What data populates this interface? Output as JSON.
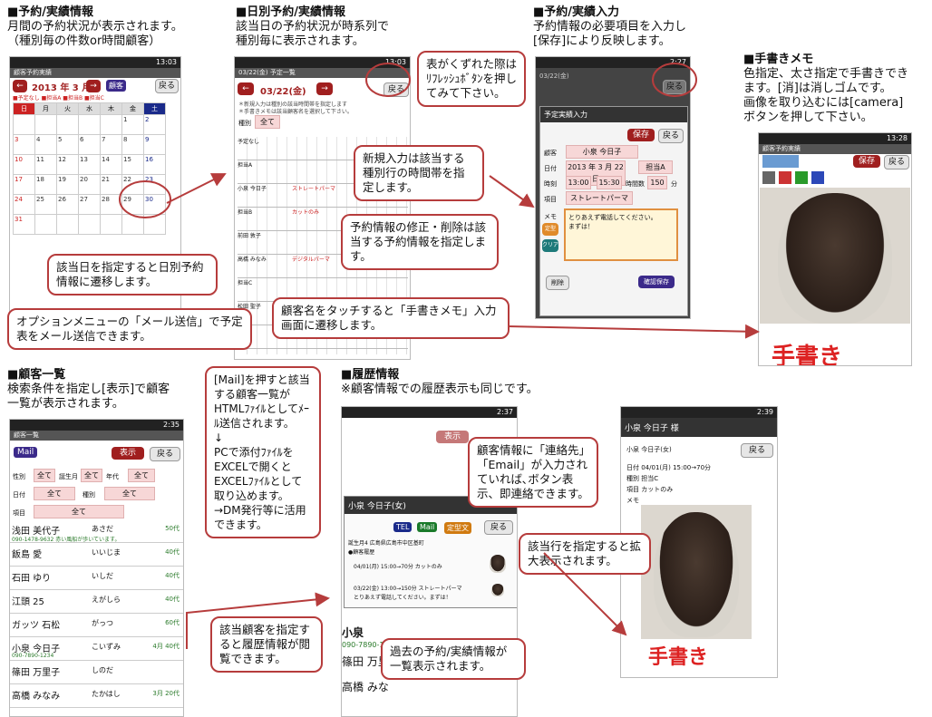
{
  "sections": {
    "s1": {
      "title": "■予約/実績情報",
      "l1": "月間の予約状況が表示されます。",
      "l2": "（種別毎の件数or時間顧客）"
    },
    "s2": {
      "title": "■日別予約/実績情報",
      "l1": "該当日の予約状況が時系列で",
      "l2": "種別毎に表示されます。"
    },
    "s3": {
      "title": "■予約/実績入力",
      "l1": "予約情報の必要項目を入力し",
      "l2": "[保存]により反映します。"
    },
    "s4": {
      "title": "■手書きメモ",
      "l1": "色指定、太さ指定で手書きでき",
      "l2": "ます。[消]は消しゴムです。",
      "l3": "画像を取り込むには[camera]",
      "l4": "ボタンを押して下さい。"
    },
    "s5": {
      "title": "■顧客一覧",
      "l1": "検索条件を指定し[表示]で顧客",
      "l2": "一覧が表示されます。"
    },
    "s6": {
      "title": "■履歴情報",
      "l1": "※顧客情報での履歴表示も同じです。"
    }
  },
  "callouts": {
    "c1": "該当日を指定すると日別予約情報に遷移します。",
    "c2": "表がくずれた際はﾘﾌﾚｯｼｭﾎﾞﾀﾝを押してみて下さい。",
    "c3": "新規入力は該当する種別行の時間帯を指定します。",
    "c4": "予約情報の修正・削除は該当する予約情報を指定します。",
    "c5": "顧客名をタッチすると「手書きメモ」入力画面に遷移します。",
    "c6": "オプションメニューの「メール送信」で予定表をメール送信できます。",
    "c7": "[Mail]を押すと該当する顧客一覧がHTMLﾌｧｲﾙとしてﾒｰﾙ送信されます。\n↓\nPCで添付ﾌｧｲﾙをEXCELで開くとEXCELﾌｧｲﾙとして取り込めます。\n→DM発行等に活用できます。",
    "c8": "顧客情報に「連絡先」「Email」が入力されていれば､ボタン表示、即連絡できます。",
    "c9": "該当行を指定すると拡大表示されます。",
    "c10": "該当顧客を指定すると履歴情報が閲覧できます。",
    "c11": "過去の予約/実績情報が一覧表示されます。"
  },
  "phone1": {
    "time": "13:03",
    "title": "顧客予約実績",
    "month": "2013 年 3 月",
    "cust": "顧客",
    "back": "戻る",
    "legend": [
      "予定なし",
      "担当A",
      "担当B",
      "担当C"
    ],
    "days": [
      "日",
      "月",
      "火",
      "水",
      "木",
      "金",
      "土"
    ],
    "dates": [
      "",
      "",
      "",
      "",
      "",
      "1",
      "2",
      "3",
      "4",
      "5",
      "6",
      "7",
      "8",
      "9",
      "10",
      "11",
      "12",
      "13",
      "14",
      "15",
      "16",
      "17",
      "18",
      "19",
      "20",
      "21",
      "22",
      "23",
      "24",
      "25",
      "26",
      "27",
      "28",
      "29",
      "30",
      "31",
      "",
      "",
      "",
      "",
      "",
      ""
    ]
  },
  "phone2": {
    "time": "13:03",
    "title": "03/22(金) 予定一覧",
    "date": "03/22(金)",
    "back": "戻る",
    "n1": "＊新規入力は種別の該当時間帯を指定します",
    "n2": "＊手書きメモは該当顧客名を選択して下さい。",
    "kind": "種別",
    "all": "全て",
    "rows": [
      "予定なし",
      "担当A",
      "小泉 今日子",
      "担当B",
      "前田 敦子",
      "高橋 みなみ",
      "担当C",
      "松田 聖子",
      "担当C"
    ],
    "items": [
      "ストレートパーマ",
      "カットのみ",
      "デジタルパーマ"
    ]
  },
  "phone3": {
    "time": "2:27",
    "date": "03/22(金)",
    "back": "戻る",
    "dlg": "予定実績入力",
    "save": "保存",
    "back2": "戻る",
    "name": "小泉 今日子",
    "date2": "2013 年 3 月 22 日",
    "staff": "担当A",
    "t1": "13:00",
    "t2": "15:30",
    "dur_lbl": "時間数",
    "dur": "150",
    "min": "分",
    "item": "ストレートパーマ",
    "memo": "とりあえず電話してください。\nまずは！",
    "del": "削除",
    "ok": "確認保存",
    "lbl": {
      "cust": "顧客",
      "date": "日付",
      "time": "時刻",
      "item": "項目",
      "memo": "メモ"
    },
    "fix": "定型",
    "clr": "クリア"
  },
  "phone4": {
    "time": "13:28",
    "title": "顧客予約実績",
    "save": "保存",
    "back": "戻る",
    "hand": "手書き"
  },
  "phone5": {
    "time": "2:35",
    "title": "顧客一覧",
    "mail": "Mail",
    "show": "表示",
    "back": "戻る",
    "filters": {
      "sex": "性別",
      "all": "全て",
      "birth": "誕生月",
      "age": "年代",
      "date": "日付",
      "kind": "種別",
      "item": "項目"
    },
    "rows": [
      {
        "name": "浅田 美代子",
        "kana": "あさだ",
        "age": "50代",
        "sub": "090-1478-9632 赤い風船が歩いています。"
      },
      {
        "name": "飯島 愛",
        "kana": "いいじま",
        "age": "40代",
        "sub": ""
      },
      {
        "name": "石田 ゆり",
        "kana": "いしだ",
        "age": "40代",
        "sub": ""
      },
      {
        "name": "江頭 25",
        "kana": "えがしら",
        "age": "40代",
        "sub": ""
      },
      {
        "name": "ガッツ 石松",
        "kana": "がっつ",
        "age": "60代",
        "sub": ""
      },
      {
        "name": "小泉 今日子",
        "kana": "こいずみ",
        "age": "4月 40代",
        "sub": "090-7890-1234"
      },
      {
        "name": "篠田 万里子",
        "kana": "しのだ",
        "age": "",
        "sub": ""
      },
      {
        "name": "高橋 みなみ",
        "kana": "たかはし",
        "age": "3月 20代",
        "sub": ""
      }
    ]
  },
  "phone6": {
    "time": "2:37",
    "dlg": "小泉 今日子(女)",
    "tel": "TEL",
    "mail": "Mail",
    "fix": "定型文",
    "back": "戻る",
    "addr": "誕生月4 広島県広島市中区基町",
    "hist": "●顧客履歴",
    "h1": "04/01(月) 15:00→70分 カットのみ",
    "h2": "03/22(金) 13:00→150分 ストレートパーマ",
    "h2m": "とりあえず電話してください。まずは！",
    "under": "小泉",
    "under2": "090-7890-12",
    "under3": "篠田 万里",
    "under4": "高橋 みな",
    "show": "表示"
  },
  "phone7": {
    "time": "2:39",
    "title": "小泉 今日子 様",
    "sub": "小泉 今日子(女)",
    "back": "戻る",
    "l1": "日付 04/01(月) 15:00→70分",
    "l2": "種別 担当C",
    "l3": "項目 カットのみ",
    "l4": "メモ",
    "hand": "手書き"
  }
}
